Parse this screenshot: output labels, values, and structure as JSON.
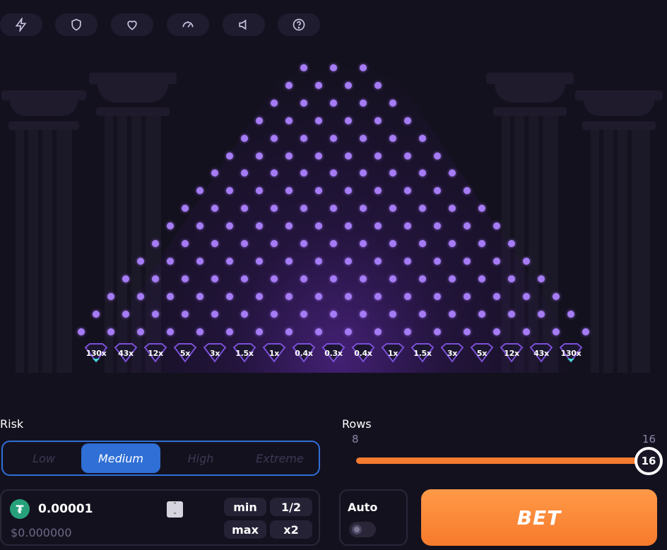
{
  "topbar": {
    "icons": [
      "lightning-icon",
      "shield-icon",
      "heart-icon",
      "speedometer-icon",
      "speaker-icon",
      "help-icon"
    ]
  },
  "board": {
    "rows": 16,
    "multipliers": [
      "130x",
      "43x",
      "12x",
      "5x",
      "3x",
      "1.5x",
      "1x",
      "0.4x",
      "0.3x",
      "0.4x",
      "1x",
      "1.5x",
      "3x",
      "5x",
      "12x",
      "43x",
      "130x"
    ],
    "peg_color": "#a57cf5",
    "bucket_border_color": "#7b4fd6"
  },
  "risk": {
    "label": "Risk",
    "options": [
      "Low",
      "Medium",
      "High",
      "Extreme"
    ],
    "selected": "Medium",
    "accent": "#2f6fd6"
  },
  "rows_slider": {
    "label": "Rows",
    "min_label": "8",
    "max_label": "16",
    "value": "16",
    "min": 8,
    "max": 16,
    "fill_color": "#f47b30"
  },
  "bet": {
    "currency_icon": "tether-icon",
    "amount": "0.00001",
    "usd_value": "$0.000000",
    "chips": [
      "min",
      "1/2",
      "max",
      "x2"
    ]
  },
  "auto": {
    "label": "Auto",
    "enabled": false
  },
  "bet_button": {
    "label": "BET",
    "color": "#f77a2c"
  }
}
